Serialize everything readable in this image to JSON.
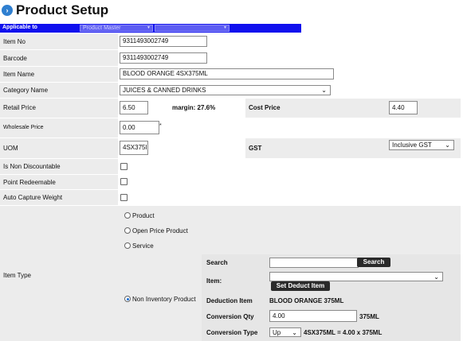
{
  "page": {
    "title": "Product Setup",
    "title_icon": "chevron-right-icon"
  },
  "applicable": {
    "label": "Applicable to",
    "option1": "Product Master",
    "option2": ""
  },
  "fields": {
    "item_no": {
      "label": "Item No",
      "value": "9311493002749"
    },
    "barcode": {
      "label": "Barcode",
      "value": "9311493002749"
    },
    "item_name": {
      "label": "Item Name",
      "value": "BLOOD ORANGE 4SX375ML"
    },
    "category": {
      "label": "Category Name",
      "value": "JUICES & CANNED DRINKS"
    },
    "retail_price": {
      "label": "Retail Price",
      "value": "6.50",
      "margin": "margin: 27.6%"
    },
    "cost_price": {
      "label": "Cost Price",
      "value": "4.40"
    },
    "wholesale_price": {
      "label": "Wholesale Price",
      "value": "0.00",
      "required_mark": "*"
    },
    "uom": {
      "label": "UOM",
      "value": "4SX375I"
    },
    "gst": {
      "label": "GST",
      "value": "Inclusive GST"
    },
    "non_discountable": {
      "label": "Is Non Discountable"
    },
    "point_redeemable": {
      "label": "Point Redeemable"
    },
    "auto_capture_weight": {
      "label": "Auto Capture Weight"
    }
  },
  "item_type": {
    "label": "Item Type",
    "options": {
      "product": "Product",
      "open_price": "Open Price Product",
      "service": "Service",
      "non_inventory": "Non Inventory Product"
    },
    "selected": "non_inventory",
    "sub": {
      "search_label": "Search",
      "search_value": "",
      "search_button": "Search",
      "item_label": "Item:",
      "item_value": "",
      "set_deduct_button": "Set Deduct Item",
      "deduction_item_label": "Deduction Item",
      "deduction_item_value": "BLOOD ORANGE 375ML",
      "conversion_qty_label": "Conversion Qty",
      "conversion_qty_value": "4.00",
      "conversion_qty_unit": "375ML",
      "conversion_type_label": "Conversion Type",
      "conversion_type_value": "Up",
      "conversion_formula": "4SX375ML = 4.00 x 375ML"
    }
  },
  "colors": {
    "accent": "#1010ee",
    "row_shade": "#ececec",
    "title_icon": "#2f7fd0",
    "button_dark": "#2a2a2a"
  }
}
